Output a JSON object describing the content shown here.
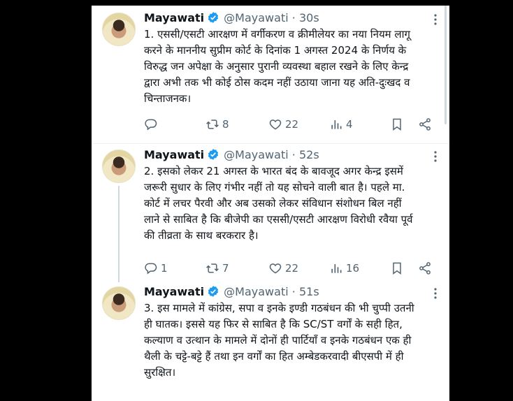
{
  "tweets": [
    {
      "name": "Mayawati",
      "handle": "@Mayawati",
      "dot": "·",
      "time": "30s",
      "text": "1. एससी/एसटी आरक्षण में वर्गीकरण व क्रीमीलेयर का नया नियम लागू\nकरने के माननीय सुप्रीम कोर्ट के दिनांक 1 अगस्त 2024 के निर्णय के\nविरुद्ध जन अपेक्षा के अनुसार पुरानी व्यवस्था बहाल रखने के लिए केन्द्र\nद्वारा अभी तक भी कोई ठोस कदम नहीं उठाया जाना यह अति-दुःखद व\nचिन्ताजनक।",
      "reply_count": "",
      "retweet_count": "8",
      "like_count": "22",
      "view_count": "4"
    },
    {
      "name": "Mayawati",
      "handle": "@Mayawati",
      "dot": "·",
      "time": "52s",
      "text": "2. इसको लेकर 21 अगस्त के भारत बंद के बावजूद अगर केन्द्र इसमें\nजरूरी सुधार के लिए गंभीर नहीं तो यह सोचने वाली बात है। पहले मा.\nकोर्ट में लचर पैरवी और अब उसको लेकर संविधान संशोधन बिल नहीं\nलाने से साबित है कि बीजेपी का एससी/एसटी आरक्षण विरोधी रवैया पूर्व\nकी तीव्रता के साथ बरकरार है।",
      "reply_count": "1",
      "retweet_count": "7",
      "like_count": "22",
      "view_count": "16"
    },
    {
      "name": "Mayawati",
      "handle": "@Mayawati",
      "dot": "·",
      "time": "51s",
      "text": "3. इस मामले में कांग्रेस, सपा व इनके इण्डी गठबंधन की भी चुप्पी उतनी\nही घातक। इससे यह फिर से साबित है कि SC/ST वर्गों के सही हित,\nकल्याण व उत्थान के मामले में दोनों ही पार्टियाँ व इनके गठबंधन एक ही\nथैली के चट्टे-बट्टे हैं तथा इन वर्गों का हित अम्बेडकरवादी बीएसपी में ही\nसुरक्षित।"
    }
  ],
  "colors": {
    "verified": "#1d9bf0",
    "icon": "#536471",
    "text": "#0f1419",
    "thread_line": "#cfd9de"
  },
  "icons": [
    "verified-badge-icon",
    "more-options-icon",
    "reply-icon",
    "retweet-icon",
    "like-icon",
    "views-icon",
    "bookmark-icon",
    "share-icon"
  ]
}
